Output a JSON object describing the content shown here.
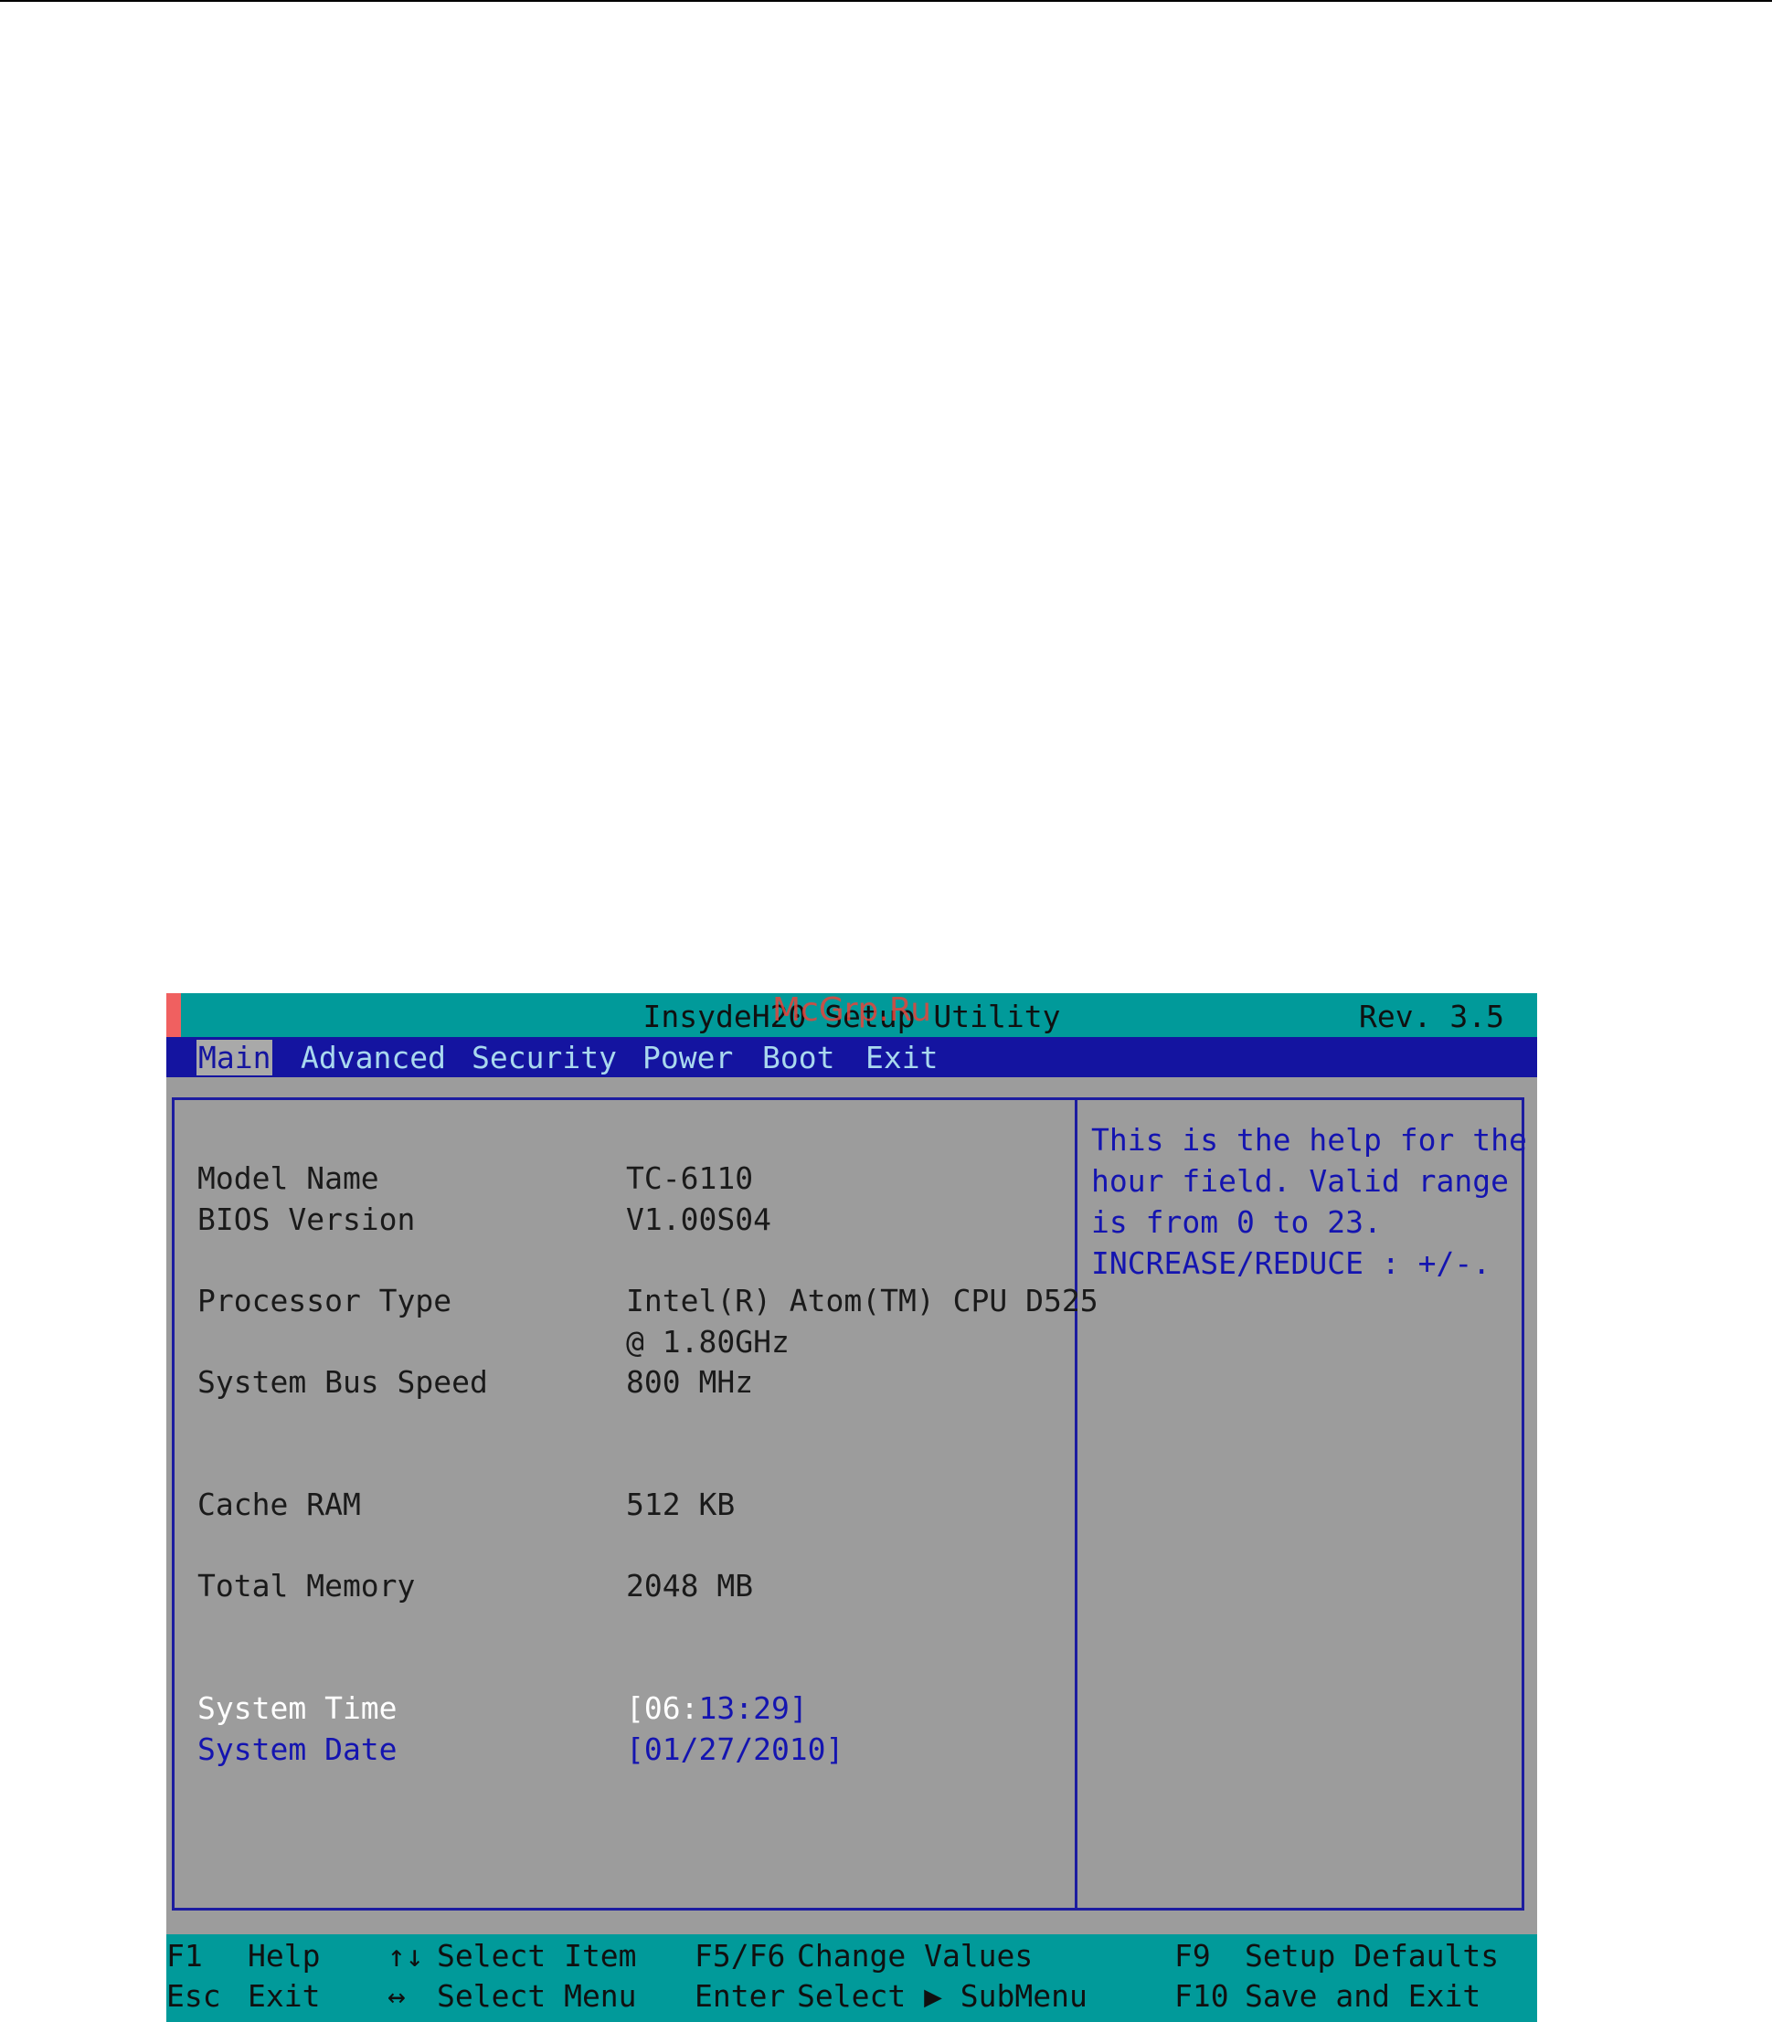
{
  "watermark": "McGrp.Ru",
  "title": {
    "app": "InsydeH20 Setup Utility",
    "rev": "Rev. 3.5"
  },
  "menu": {
    "items": [
      "Main",
      "Advanced",
      "Security",
      "Power",
      "Boot",
      "Exit"
    ],
    "active": "Main"
  },
  "fields": {
    "model_name": {
      "label": "Model Name",
      "value": "TC-6110"
    },
    "bios_version": {
      "label": "BIOS Version",
      "value": "V1.00S04"
    },
    "processor_type": {
      "label": "Processor Type",
      "value_line1": "Intel(R) Atom(TM) CPU D525",
      "value_line2": "@ 1.80GHz"
    },
    "system_bus_speed": {
      "label": "System Bus Speed",
      "value": "800 MHz"
    },
    "cache_ram": {
      "label": "Cache RAM",
      "value": "512 KB"
    },
    "total_memory": {
      "label": "Total Memory",
      "value": "2048 MB"
    },
    "system_time": {
      "label": "System Time",
      "open": "[",
      "hour": "06",
      "sep": ":",
      "rest": "13:29]"
    },
    "system_date": {
      "label": "System Date",
      "value": "[01/27/2010]"
    }
  },
  "help": {
    "lines": [
      "This is the help for the",
      "hour field. Valid range",
      "is from 0 to 23.",
      "INCREASE/REDUCE : +/-."
    ]
  },
  "footer": {
    "f1_key": "F1",
    "f1_desc": "Help",
    "esc_key": "Esc",
    "esc_desc": "Exit",
    "updown_key": "↑↓",
    "updown_desc": "Select Item",
    "leftright_key": "↔",
    "leftright_desc": "Select Menu",
    "f5f6_key": "F5/F6",
    "f5f6_desc": "Change Values",
    "enter_key": "Enter",
    "enter_desc": "Select ▶ SubMenu",
    "f9_key": "F9",
    "f9_desc": "Setup Defaults",
    "f10_key": "F10",
    "f10_desc": "Save and Exit"
  },
  "colors": {
    "titlebar": "#019a9a",
    "menubar": "#1414a0",
    "panel": "#9c9c9c",
    "highlight_blue": "#1414b0"
  }
}
